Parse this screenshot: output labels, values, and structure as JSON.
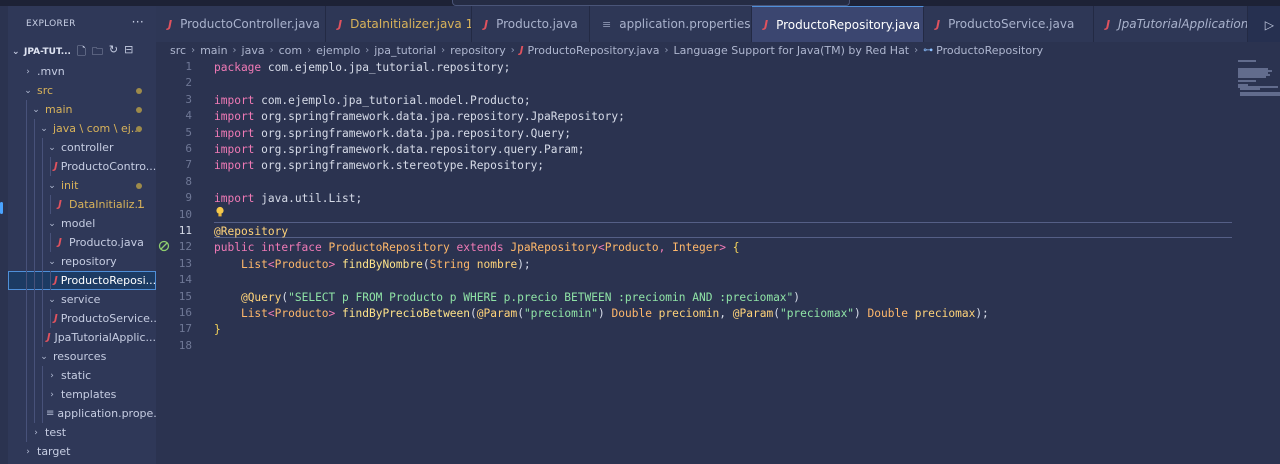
{
  "explorer": {
    "title": "EXPLORER",
    "more": "···",
    "project": "JPA-TUT...",
    "tree": [
      {
        "label": ".mvn",
        "kind": "folder",
        "open": false,
        "depth": 1
      },
      {
        "label": "src",
        "kind": "folder",
        "open": true,
        "depth": 1,
        "modified": true
      },
      {
        "label": "main",
        "kind": "folder",
        "open": true,
        "depth": 2,
        "modified": true
      },
      {
        "label": "java \\ com \\ ej...",
        "kind": "folder",
        "open": true,
        "depth": 3,
        "modified": true
      },
      {
        "label": "controller",
        "kind": "folder",
        "open": true,
        "depth": 4
      },
      {
        "label": "ProductoContro...",
        "kind": "java",
        "depth": 5
      },
      {
        "label": "init",
        "kind": "folder",
        "open": true,
        "depth": 4,
        "modified": true
      },
      {
        "label": "DataInitializ...",
        "kind": "java",
        "depth": 5,
        "modified": true,
        "badge": "1"
      },
      {
        "label": "model",
        "kind": "folder",
        "open": true,
        "depth": 4
      },
      {
        "label": "Producto.java",
        "kind": "java",
        "depth": 5
      },
      {
        "label": "repository",
        "kind": "folder",
        "open": true,
        "depth": 4
      },
      {
        "label": "ProductoReposi...",
        "kind": "java",
        "depth": 5,
        "selected": true
      },
      {
        "label": "service",
        "kind": "folder",
        "open": true,
        "depth": 4
      },
      {
        "label": "ProductoService...",
        "kind": "java",
        "depth": 5
      },
      {
        "label": "JpaTutorialApplic...",
        "kind": "java",
        "depth": 4
      },
      {
        "label": "resources",
        "kind": "folder",
        "open": true,
        "depth": 3
      },
      {
        "label": "static",
        "kind": "folder",
        "open": false,
        "depth": 4
      },
      {
        "label": "templates",
        "kind": "folder",
        "open": false,
        "depth": 4
      },
      {
        "label": "application.prope...",
        "kind": "props",
        "depth": 4
      },
      {
        "label": "test",
        "kind": "folder",
        "open": false,
        "depth": 2
      },
      {
        "label": "target",
        "kind": "folder",
        "open": false,
        "depth": 1
      }
    ]
  },
  "tabs": [
    {
      "label": "ProductoController.java",
      "kind": "java"
    },
    {
      "label": "DataInitializer.java 1",
      "kind": "java",
      "modified": true
    },
    {
      "label": "Producto.java",
      "kind": "java"
    },
    {
      "label": "application.properties",
      "kind": "props"
    },
    {
      "label": "ProductoRepository.java",
      "kind": "java",
      "active": true
    },
    {
      "label": "ProductoService.java",
      "kind": "java"
    },
    {
      "label": "JpaTutorialApplication.java",
      "kind": "java",
      "italic": true
    }
  ],
  "breadcrumb": [
    "src",
    "main",
    "java",
    "com",
    "ejemplo",
    "jpa_tutorial",
    "repository",
    "ProductoRepository.java",
    "Language Support for Java(TM) by Red Hat",
    "ProductoRepository"
  ],
  "editor": {
    "current_line": 11,
    "lines": [
      {
        "n": "1",
        "code": [
          [
            "k",
            "package"
          ],
          [
            "pk",
            " com.ejemplo.jpa_tutorial.repository;"
          ]
        ]
      },
      {
        "n": "2",
        "code": []
      },
      {
        "n": "3",
        "code": [
          [
            "k",
            "import"
          ],
          [
            "pk",
            " com.ejemplo.jpa_tutorial.model.Producto;"
          ]
        ]
      },
      {
        "n": "4",
        "code": [
          [
            "k",
            "import"
          ],
          [
            "pk",
            " org.springframework.data.jpa.repository.JpaRepository;"
          ]
        ]
      },
      {
        "n": "5",
        "code": [
          [
            "k",
            "import"
          ],
          [
            "pk",
            " org.springframework.data.jpa.repository.Query;"
          ]
        ]
      },
      {
        "n": "6",
        "code": [
          [
            "k",
            "import"
          ],
          [
            "pk",
            " org.springframework.data.repository.query.Param;"
          ]
        ]
      },
      {
        "n": "7",
        "code": [
          [
            "k",
            "import"
          ],
          [
            "pk",
            " org.springframework.stereotype.Repository;"
          ]
        ]
      },
      {
        "n": "8",
        "code": []
      },
      {
        "n": "9",
        "code": [
          [
            "k",
            "import"
          ],
          [
            "pk",
            " java.util.List;"
          ]
        ]
      },
      {
        "n": "10",
        "code": []
      },
      {
        "n": "11",
        "code": [
          [
            "ann",
            "@Repository"
          ]
        ]
      },
      {
        "n": "12",
        "code": [
          [
            "k",
            "public interface "
          ],
          [
            "ty",
            "ProductoRepository"
          ],
          [
            "k",
            " extends "
          ],
          [
            "ty",
            "JpaRepository"
          ],
          [
            "k",
            "<"
          ],
          [
            "ty",
            "Producto"
          ],
          [
            "k",
            ", "
          ],
          [
            "ty",
            "Integer"
          ],
          [
            "k",
            "> "
          ],
          [
            "br",
            "{"
          ]
        ]
      },
      {
        "n": "13",
        "code": [
          [
            "pk",
            "    "
          ],
          [
            "ty",
            "List"
          ],
          [
            "k",
            "<"
          ],
          [
            "ty",
            "Producto"
          ],
          [
            "k",
            "> "
          ],
          [
            "fn",
            "findByNombre"
          ],
          [
            "pk",
            "("
          ],
          [
            "ty",
            "String"
          ],
          [
            "pr",
            " nombre"
          ],
          [
            "pk",
            ");"
          ]
        ]
      },
      {
        "n": "14",
        "code": []
      },
      {
        "n": "15",
        "code": [
          [
            "pk",
            "    "
          ],
          [
            "ann",
            "@Query"
          ],
          [
            "pk",
            "("
          ],
          [
            "str",
            "\"SELECT p FROM Producto p WHERE p.precio BETWEEN :preciomin AND :preciomax\""
          ],
          [
            "pk",
            ")"
          ]
        ]
      },
      {
        "n": "16",
        "code": [
          [
            "pk",
            "    "
          ],
          [
            "ty",
            "List"
          ],
          [
            "k",
            "<"
          ],
          [
            "ty",
            "Producto"
          ],
          [
            "k",
            "> "
          ],
          [
            "fn",
            "findByPrecioBetween"
          ],
          [
            "pk",
            "("
          ],
          [
            "ann",
            "@Param"
          ],
          [
            "pk",
            "("
          ],
          [
            "str",
            "\"preciomin\""
          ],
          [
            "pk",
            ") "
          ],
          [
            "ty",
            "Double"
          ],
          [
            "pr",
            " preciomin"
          ],
          [
            "pk",
            ", "
          ],
          [
            "ann",
            "@Param"
          ],
          [
            "pk",
            "("
          ],
          [
            "str",
            "\"preciomax\""
          ],
          [
            "pk",
            ") "
          ],
          [
            "ty",
            "Double"
          ],
          [
            "pr",
            " preciomax"
          ],
          [
            "pk",
            ");"
          ]
        ]
      },
      {
        "n": "17",
        "code": [
          [
            "br",
            "}"
          ]
        ]
      },
      {
        "n": "18",
        "code": []
      }
    ]
  }
}
